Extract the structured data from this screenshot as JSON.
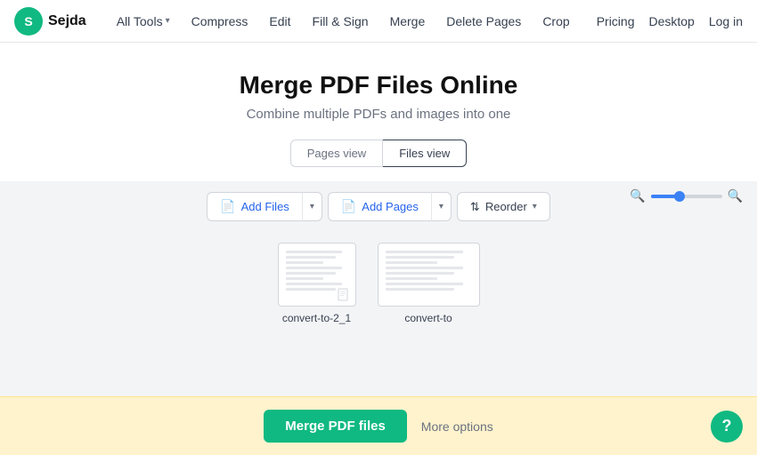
{
  "logo": {
    "text": "Sejda",
    "initial": "S"
  },
  "nav": {
    "all_tools": "All Tools",
    "compress": "Compress",
    "edit": "Edit",
    "fill_sign": "Fill & Sign",
    "merge": "Merge",
    "delete_pages": "Delete Pages",
    "crop": "Crop",
    "pricing": "Pricing",
    "desktop": "Desktop",
    "login": "Log in"
  },
  "header": {
    "title": "Merge PDF Files Online",
    "subtitle": "Combine multiple PDFs and images into one"
  },
  "view_toggle": {
    "pages_view": "Pages view",
    "files_view": "Files view"
  },
  "toolbar": {
    "add_files": "Add Files",
    "add_pages": "Add Pages",
    "reorder": "Reorder"
  },
  "files": [
    {
      "name": "convert-to-2_1",
      "width": 88,
      "height": 72
    },
    {
      "name": "convert-to",
      "width": 115,
      "height": 72
    }
  ],
  "bottom": {
    "merge_label": "Merge PDF files",
    "more_options": "More options"
  },
  "colors": {
    "accent": "#10b981",
    "blue": "#2563eb"
  }
}
